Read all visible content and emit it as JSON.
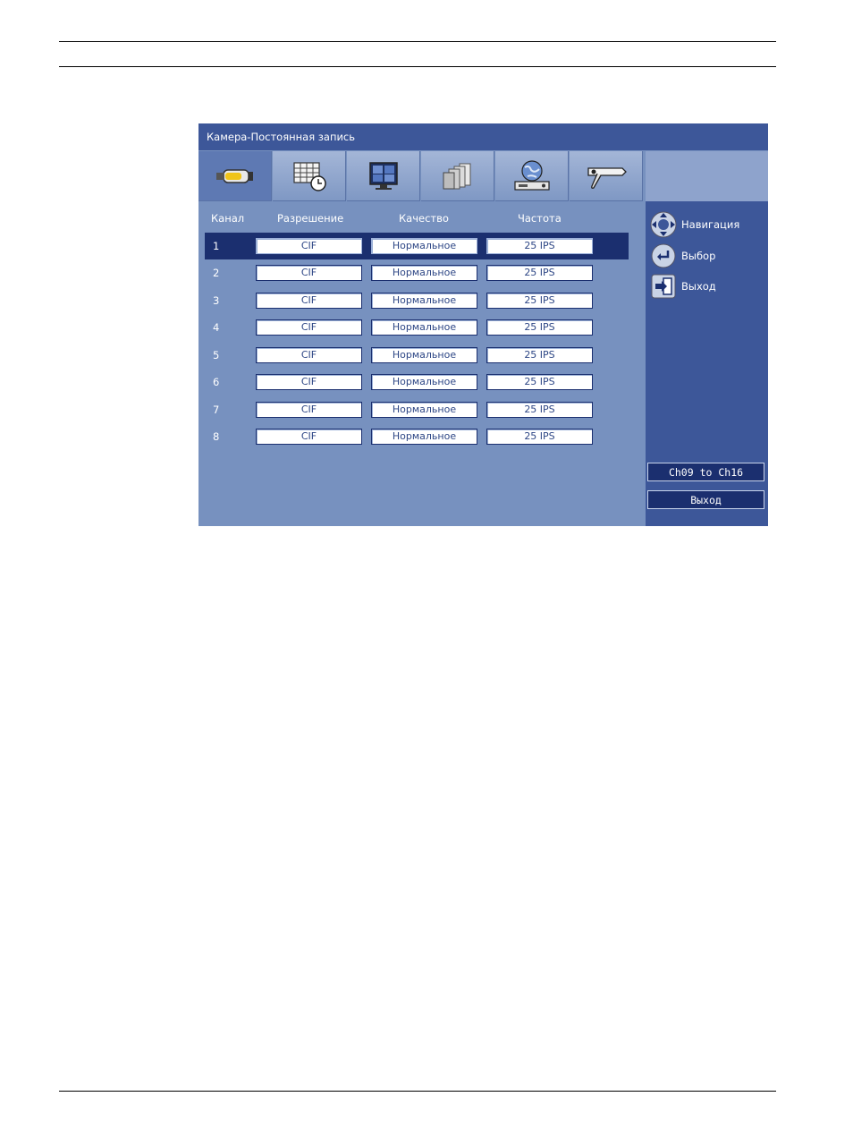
{
  "window": {
    "title": "Камера-Постоянная запись"
  },
  "tabs": [
    {
      "icon": "camera-icon"
    },
    {
      "icon": "schedule-icon"
    },
    {
      "icon": "monitor-icon"
    },
    {
      "icon": "recording-icon"
    },
    {
      "icon": "network-icon"
    },
    {
      "icon": "tools-icon"
    }
  ],
  "table": {
    "headers": [
      "Канал",
      "Разрешение",
      "Качество",
      "Частота"
    ],
    "rows": [
      {
        "channel": "1",
        "resolution": "CIF",
        "quality": "Нормальное",
        "rate": "25  IPS"
      },
      {
        "channel": "2",
        "resolution": "CIF",
        "quality": "Нормальное",
        "rate": "25  IPS"
      },
      {
        "channel": "3",
        "resolution": "CIF",
        "quality": "Нормальное",
        "rate": "25  IPS"
      },
      {
        "channel": "4",
        "resolution": "CIF",
        "quality": "Нормальное",
        "rate": "25  IPS"
      },
      {
        "channel": "5",
        "resolution": "CIF",
        "quality": "Нормальное",
        "rate": "25  IPS"
      },
      {
        "channel": "6",
        "resolution": "CIF",
        "quality": "Нормальное",
        "rate": "25  IPS"
      },
      {
        "channel": "7",
        "resolution": "CIF",
        "quality": "Нормальное",
        "rate": "25  IPS"
      },
      {
        "channel": "8",
        "resolution": "CIF",
        "quality": "Нормальное",
        "rate": "25  IPS"
      }
    ],
    "selected_row": 1
  },
  "sidebar": {
    "legend": [
      {
        "label": "Навигация",
        "icon": "navigation-icon"
      },
      {
        "label": "Выбор",
        "icon": "enter-icon"
      },
      {
        "label": "Выход",
        "icon": "exit-icon"
      }
    ],
    "channels_button": "Ch09 to Ch16",
    "exit_button": "Выход"
  },
  "colors": {
    "panel": "#7791bf",
    "titlebar": "#3d5799",
    "selection": "#1b2f6f"
  }
}
